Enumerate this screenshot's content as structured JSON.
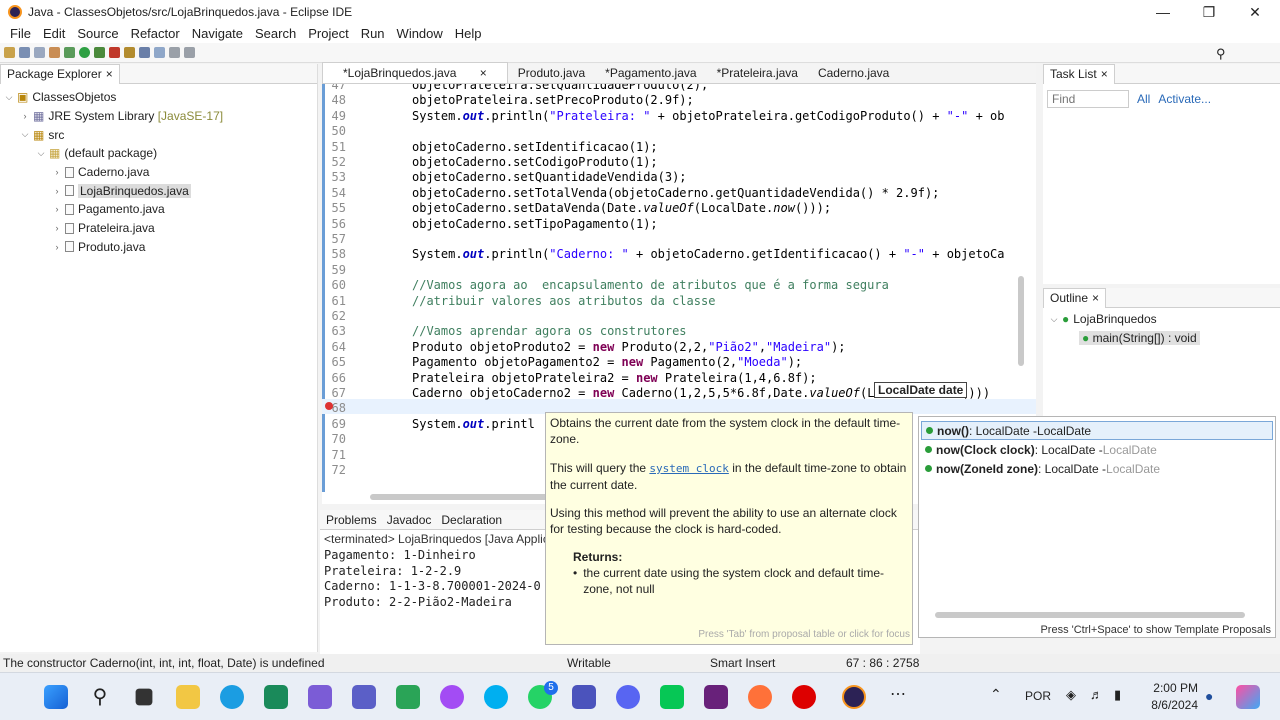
{
  "window": {
    "title": "Java - ClassesObjetos/src/LojaBrinquedos.java - Eclipse IDE"
  },
  "menu": [
    "File",
    "Edit",
    "Source",
    "Refactor",
    "Navigate",
    "Search",
    "Project",
    "Run",
    "Window",
    "Help"
  ],
  "package_explorer": {
    "title": "Package Explorer",
    "project": "ClassesObjetos",
    "jre": "JRE System Library",
    "jre_version": "[JavaSE-17]",
    "src": "src",
    "pkg": "(default package)",
    "files": [
      "Caderno.java",
      "LojaBrinquedos.java",
      "Pagamento.java",
      "Prateleira.java",
      "Produto.java"
    ]
  },
  "editor_tabs": [
    "*LojaBrinquedos.java",
    "Produto.java",
    "*Pagamento.java",
    "*Prateleira.java",
    "Caderno.java"
  ],
  "code_lines": [
    {
      "n": "47",
      "t": "objetoPrateleira.setQuantidadeProduto(2);"
    },
    {
      "n": "48",
      "t": "objetoPrateleira.setPrecoProduto(2.9f);"
    },
    {
      "n": "49",
      "t": "System.out.println(\"Prateleira: \" + objetoPrateleira.getCodigoProduto() + \"-\" + ob"
    },
    {
      "n": "50",
      "t": ""
    },
    {
      "n": "51",
      "t": "objetoCaderno.setIdentificacao(1);"
    },
    {
      "n": "52",
      "t": "objetoCaderno.setCodigoProduto(1);"
    },
    {
      "n": "53",
      "t": "objetoCaderno.setQuantidadeVendida(3);"
    },
    {
      "n": "54",
      "t": "objetoCaderno.setTotalVenda(objetoCaderno.getQuantidadeVendida() * 2.9f);"
    },
    {
      "n": "55",
      "t": "objetoCaderno.setDataVenda(Date.valueOf(LocalDate.now()));"
    },
    {
      "n": "56",
      "t": "objetoCaderno.setTipoPagamento(1);"
    },
    {
      "n": "57",
      "t": ""
    },
    {
      "n": "58",
      "t": "System.out.println(\"Caderno: \" + objetoCaderno.getIdentificacao() + \"-\" + objetoCa"
    },
    {
      "n": "59",
      "t": ""
    },
    {
      "n": "60",
      "t": "//Vamos agora ao  encapsulamento de atributos que é a forma segura"
    },
    {
      "n": "61",
      "t": "//atribuir valores aos atributos da classe"
    },
    {
      "n": "62",
      "t": ""
    },
    {
      "n": "63",
      "t": "//Vamos aprendar agora os construtores"
    },
    {
      "n": "64",
      "t": "Produto objetoProduto2 = new Produto(2,2,\"Pião2\",\"Madeira\");"
    },
    {
      "n": "65",
      "t": "Pagamento objetoPagamento2 = new Pagamento(2,\"Moeda\");"
    },
    {
      "n": "66",
      "t": "Prateleira objetoPrateleira2 = new Prateleira(1,4,6.8f);"
    },
    {
      "n": "67",
      "t": "Caderno objetoCaderno2 = new Caderno(1,2,5,5*6.8f,Date.valueOf(LocalDate.now()))"
    },
    {
      "n": "68",
      "t": ""
    },
    {
      "n": "69",
      "t": "System.out.printl"
    },
    {
      "n": "70",
      "t": ""
    },
    {
      "n": "71",
      "t": ""
    },
    {
      "n": "72",
      "t": ""
    }
  ],
  "hover_hint": "LocalDate date",
  "task_list": {
    "title": "Task List",
    "find_placeholder": "Find",
    "all": "All",
    "activate": "Activate..."
  },
  "outline": {
    "title": "Outline",
    "class": "LojaBrinquedos",
    "method": "main(String[]) : void"
  },
  "console": {
    "tabs": [
      "Problems",
      "Javadoc",
      "Declaration"
    ],
    "header": "<terminated> LojaBrinquedos [Java Applic",
    "lines": [
      "Pagamento: 1-Dinheiro",
      "Prateleira: 1-2-2.9",
      "Caderno: 1-1-3-8.700001-2024-0",
      "Produto: 2-2-Pião2-Madeira"
    ]
  },
  "javadoc": {
    "p1": "Obtains the current date from the system clock in the default time-zone.",
    "p2_a": "This will query the ",
    "p2_link": "system clock",
    "p2_b": " in the default time-zone to obtain the current date.",
    "p3": "Using this method will prevent the ability to use an alternate clock for testing because the clock is hard-coded.",
    "returns_label": "Returns:",
    "returns_text": "the current date using the system clock and default time-zone, not null",
    "footer": "Press 'Tab' from proposal table or click for focus"
  },
  "proposals": [
    {
      "name": "now()",
      "sig": " : LocalDate - ",
      "type": "LocalDate"
    },
    {
      "name": "now(Clock clock)",
      "sig": " : LocalDate - ",
      "type": "LocalDate"
    },
    {
      "name": "now(ZoneId zone)",
      "sig": " : LocalDate - ",
      "type": "LocalDate"
    }
  ],
  "proposals_footer": "Press 'Ctrl+Space' to show Template Proposals",
  "status": {
    "message": "The constructor Caderno(int, int, int, float, Date) is undefined",
    "writable": "Writable",
    "insert": "Smart Insert",
    "position": "67 : 86 : 2758"
  },
  "taskbar": {
    "lang": "POR",
    "time": "2:00 PM",
    "date": "8/6/2024",
    "whatsapp_badge": "5"
  }
}
